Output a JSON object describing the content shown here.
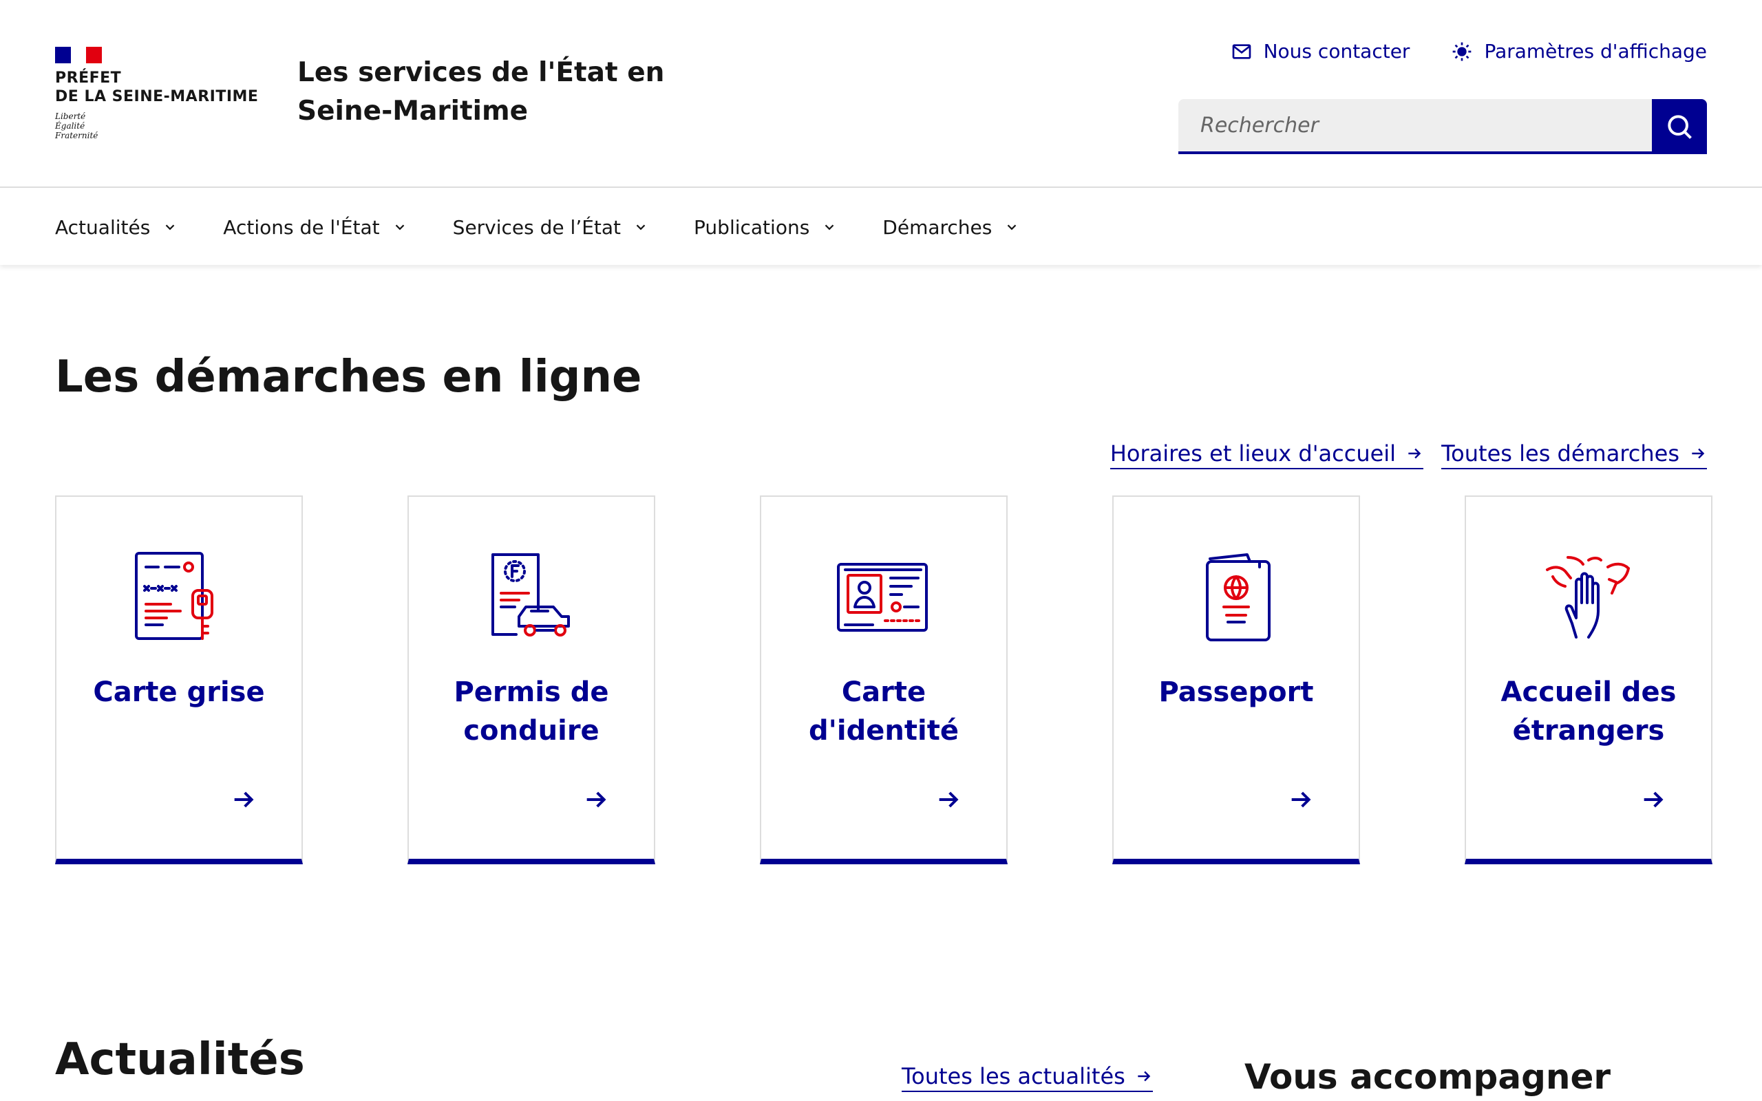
{
  "header": {
    "logo": {
      "prefect_line1": "PRÉFET",
      "prefect_line2": "DE LA SEINE-MARITIME",
      "motto": [
        "Liberté",
        "Égalité",
        "Fraternité"
      ]
    },
    "site_title": "Les services de l'État en Seine-Maritime",
    "tools": {
      "contact_label": "Nous contacter",
      "display_label": "Paramètres d'affichage"
    },
    "search": {
      "placeholder": "Rechercher"
    }
  },
  "nav": {
    "items": [
      "Actualités",
      "Actions de l'État",
      "Services de l’État",
      "Publications",
      "Démarches"
    ]
  },
  "demarches": {
    "title": "Les démarches en ligne",
    "links": {
      "horaires": "Horaires et lieux d'accueil",
      "toutes": "Toutes les démarches"
    },
    "cards": [
      {
        "title": "Carte grise",
        "icon": "vehicle-registration-icon"
      },
      {
        "title": "Permis de conduire",
        "icon": "driving-license-icon"
      },
      {
        "title": "Carte d'identité",
        "icon": "identity-card-icon"
      },
      {
        "title": "Passeport",
        "icon": "passport-icon"
      },
      {
        "title": "Accueil des étrangers",
        "icon": "welcome-hands-icon"
      }
    ]
  },
  "actualites": {
    "title": "Actualités",
    "all_link": "Toutes les actualités",
    "side_title": "Vous accompagner"
  },
  "colors": {
    "primary": "#000091",
    "accent_red": "#e1000f",
    "border": "#dddddd",
    "search_bg": "#eeeeee"
  }
}
